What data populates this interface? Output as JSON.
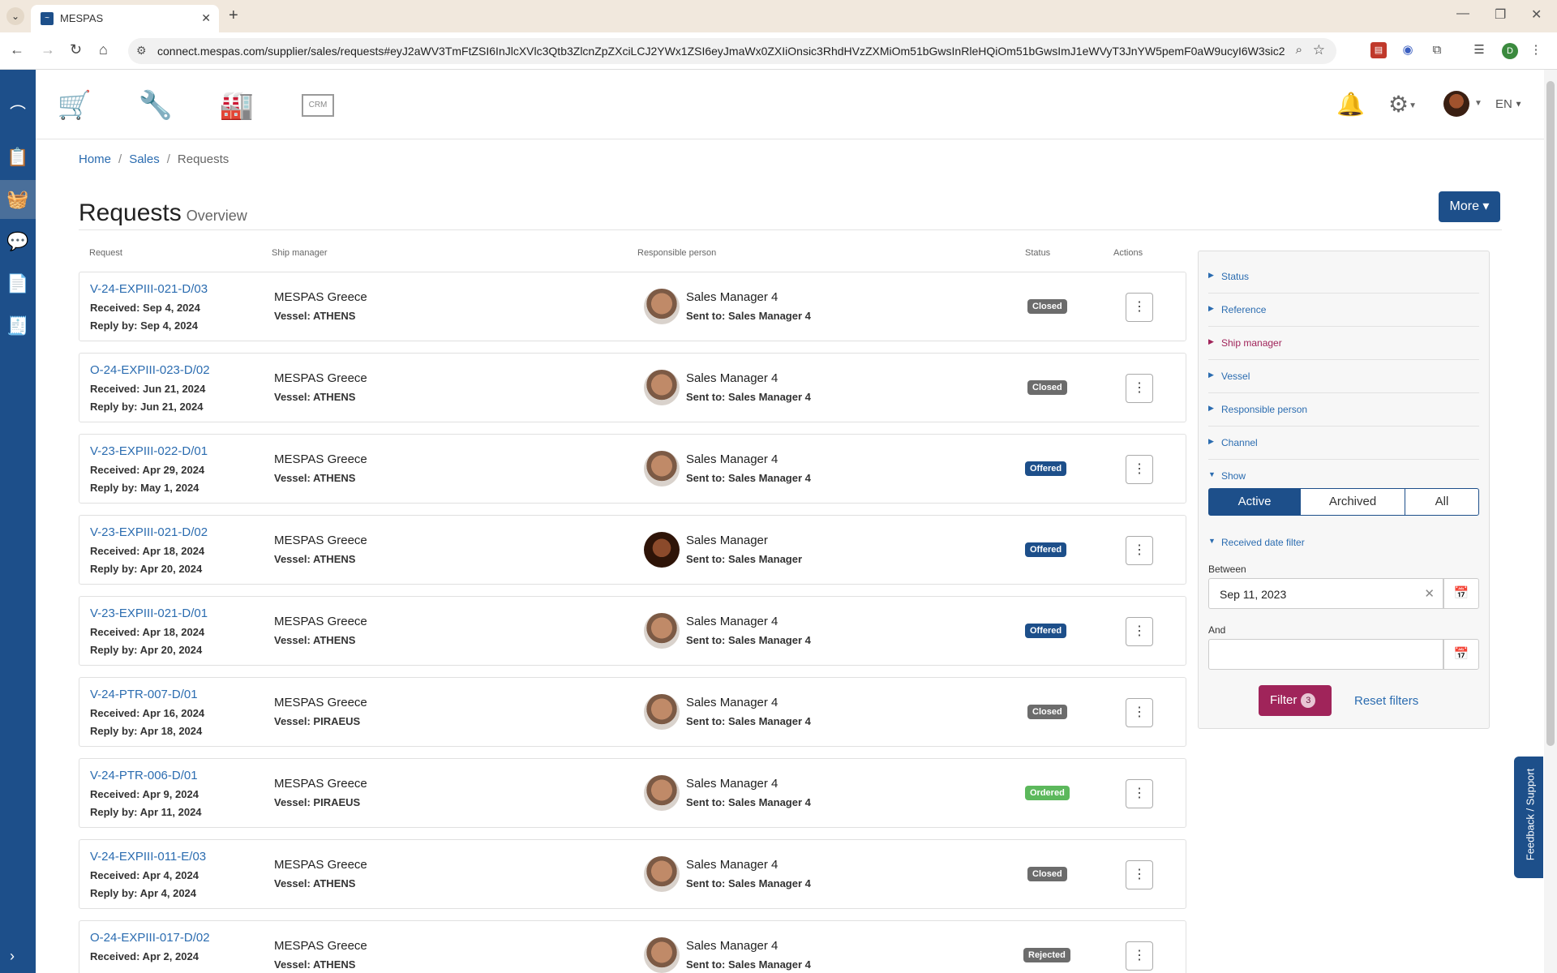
{
  "browser": {
    "tab_title": "MESPAS",
    "url": "connect.mespas.com/supplier/sales/requests#eyJ2aWV3TmFtZSI6InJlcXVlc3Qtb3ZlcnZpZXciLCJ2YWx1ZSI6eyJmaWx0ZXIiOnsic3RhdHVzZXMiOm51bGwsInRleHQiOm51bGwsImJ1eWVyT3JnYW5pemF0aW9ucyI6W3sic2VjdGlvbkl...",
    "profile_initial": "D"
  },
  "header": {
    "crm_label": "CRM",
    "language": "EN"
  },
  "breadcrumb": {
    "home": "Home",
    "sales": "Sales",
    "current": "Requests"
  },
  "page": {
    "title": "Requests",
    "subtitle": "Overview",
    "more_label": "More"
  },
  "table": {
    "columns": {
      "request": "Request",
      "ship_manager": "Ship manager",
      "responsible": "Responsible person",
      "status": "Status",
      "actions": "Actions"
    },
    "rows": [
      {
        "ref": "V-24-EXPIII-021-D/03",
        "received": "Received: Sep 4, 2024",
        "reply": "Reply by: Sep 4, 2024",
        "manager": "MESPAS Greece",
        "vessel": "Vessel: ATHENS",
        "person": "Sales Manager 4",
        "sent": "Sent to: Sales Manager 4",
        "status": "Closed",
        "status_class": "closed",
        "avatar": "male"
      },
      {
        "ref": "O-24-EXPIII-023-D/02",
        "received": "Received: Jun 21, 2024",
        "reply": "Reply by: Jun 21, 2024",
        "manager": "MESPAS Greece",
        "vessel": "Vessel: ATHENS",
        "person": "Sales Manager 4",
        "sent": "Sent to: Sales Manager 4",
        "status": "Closed",
        "status_class": "closed",
        "avatar": "male"
      },
      {
        "ref": "V-23-EXPIII-022-D/01",
        "received": "Received: Apr 29, 2024",
        "reply": "Reply by: May 1, 2024",
        "manager": "MESPAS Greece",
        "vessel": "Vessel: ATHENS",
        "person": "Sales Manager 4",
        "sent": "Sent to: Sales Manager 4",
        "status": "Offered",
        "status_class": "offered",
        "avatar": "male"
      },
      {
        "ref": "V-23-EXPIII-021-D/02",
        "received": "Received: Apr 18, 2024",
        "reply": "Reply by: Apr 20, 2024",
        "manager": "MESPAS Greece",
        "vessel": "Vessel: ATHENS",
        "person": "Sales Manager",
        "sent": "Sent to: Sales Manager",
        "status": "Offered",
        "status_class": "offered",
        "avatar": "female"
      },
      {
        "ref": "V-23-EXPIII-021-D/01",
        "received": "Received: Apr 18, 2024",
        "reply": "Reply by: Apr 20, 2024",
        "manager": "MESPAS Greece",
        "vessel": "Vessel: ATHENS",
        "person": "Sales Manager 4",
        "sent": "Sent to: Sales Manager 4",
        "status": "Offered",
        "status_class": "offered",
        "avatar": "male"
      },
      {
        "ref": "V-24-PTR-007-D/01",
        "received": "Received: Apr 16, 2024",
        "reply": "Reply by: Apr 18, 2024",
        "manager": "MESPAS Greece",
        "vessel": "Vessel: PIRAEUS",
        "person": "Sales Manager 4",
        "sent": "Sent to: Sales Manager 4",
        "status": "Closed",
        "status_class": "closed",
        "avatar": "male"
      },
      {
        "ref": "V-24-PTR-006-D/01",
        "received": "Received: Apr 9, 2024",
        "reply": "Reply by: Apr 11, 2024",
        "manager": "MESPAS Greece",
        "vessel": "Vessel: PIRAEUS",
        "person": "Sales Manager 4",
        "sent": "Sent to: Sales Manager 4",
        "status": "Ordered",
        "status_class": "ordered",
        "avatar": "male"
      },
      {
        "ref": "V-24-EXPIII-011-E/03",
        "received": "Received: Apr 4, 2024",
        "reply": "Reply by: Apr 4, 2024",
        "manager": "MESPAS Greece",
        "vessel": "Vessel: ATHENS",
        "person": "Sales Manager 4",
        "sent": "Sent to: Sales Manager 4",
        "status": "Closed",
        "status_class": "closed",
        "avatar": "male"
      },
      {
        "ref": "O-24-EXPIII-017-D/02",
        "received": "Received: Apr 2, 2024",
        "reply": "",
        "manager": "MESPAS Greece",
        "vessel": "Vessel: ATHENS",
        "person": "Sales Manager 4",
        "sent": "Sent to: Sales Manager 4",
        "status": "Rejected",
        "status_class": "rejected",
        "avatar": "male"
      }
    ]
  },
  "filters": {
    "sections": [
      {
        "label": "Status",
        "active": false
      },
      {
        "label": "Reference",
        "active": false
      },
      {
        "label": "Ship manager",
        "active": true
      },
      {
        "label": "Vessel",
        "active": false
      },
      {
        "label": "Responsible person",
        "active": false
      },
      {
        "label": "Channel",
        "active": false
      }
    ],
    "show_label": "Show",
    "show_options": [
      "Active",
      "Archived",
      "All"
    ],
    "show_selected": "Active",
    "date_filter_label": "Received date filter",
    "between_label": "Between",
    "between_value": "Sep 11, 2023",
    "and_label": "And",
    "and_value": "",
    "filter_label": "Filter",
    "filter_count": "3",
    "reset_label": "Reset filters"
  },
  "feedback_label": "Feedback / Support",
  "colors": {
    "brand": "#1d4f8a",
    "accent": "#a0245a",
    "ordered": "#5cb85c",
    "closed": "#6c6c6c"
  }
}
